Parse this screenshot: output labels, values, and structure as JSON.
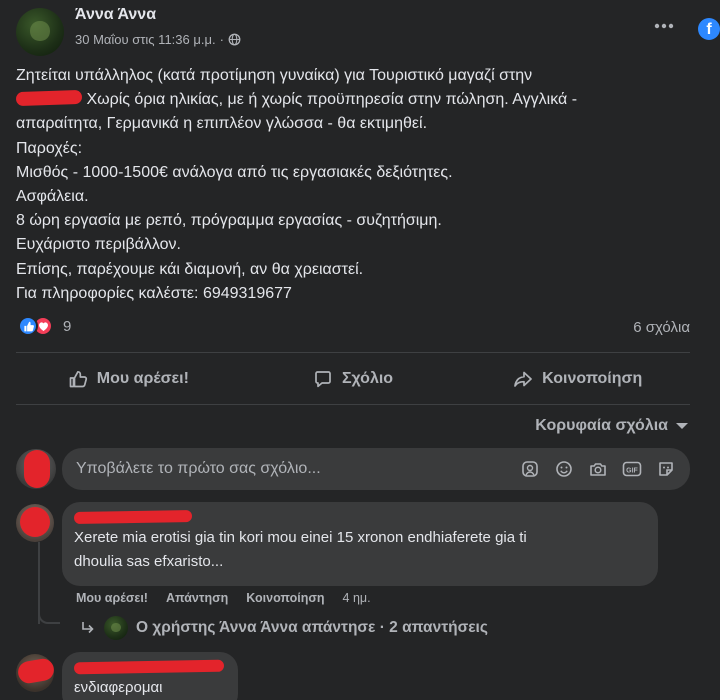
{
  "post": {
    "author": "Άννα Άννα",
    "timestamp": "30 Μαΐου στις 11:36 μ.μ.",
    "separator": "·",
    "privacy_icon": "globe-icon",
    "body": {
      "line1": "Ζητείται υπάλληλος (κατά προτίμηση γυναίκα) για Τουριστικό μαγαζί στην",
      "line2_after_redaction": " Χωρίς όρια ηλικίας, με ή χωρίς προϋπηρεσία στην πώληση. Αγγλικά -",
      "line3": "απαραίτητα, Γερμανικά η επιπλέον γλώσσα - θα εκτιμηθεί.",
      "line4": "Παροχές:",
      "line5": "Μισθός - 1000-1500€ ανάλογα από τις εργασιακές δεξιότητες.",
      "line6": "Ασφάλεια.",
      "line7": "8 ώρη εργασία με ρεπό, πρόγραμμα εργασίας - συζητήσιμη.",
      "line8": "Ευχάριστο περιβάλλον.",
      "line9": "Επίσης, παρέχουμε κάι διαμονή, αν θα χρειαστεί.",
      "line10": "Για πληροφορίες καλέστε: 6949319677"
    },
    "reaction_count": "9",
    "comment_count": "6 σχόλια"
  },
  "actions": {
    "like": "Μου αρέσει!",
    "comment": "Σχόλιο",
    "share": "Κοινοποίηση"
  },
  "sort_label": "Κορυφαία σχόλια",
  "composer": {
    "placeholder": "Υποβάλετε το πρώτο σας σχόλιο..."
  },
  "comments": [
    {
      "text_line1": "Xerete mia erotisi gia tin kori mou einei 15 xronon endhiaferete gia ti",
      "text_line2": "dhoulia sas efxaristo...",
      "like": "Μου αρέσει!",
      "reply": "Απάντηση",
      "share": "Κοινοποίηση",
      "time": "4 ημ.",
      "replies_text": "Ο χρήστης Άννα Άννα απάντησε · 2 απαντήσεις"
    },
    {
      "text": "ενδιαφερομαι"
    }
  ],
  "colors": {
    "background": "#242526",
    "bubble": "#3a3b3c",
    "primary_text": "#e4e6eb",
    "secondary_text": "#b0b3b8",
    "like_blue": "#2d88ff",
    "love_red": "#f33e58",
    "redaction": "#e3242b"
  }
}
